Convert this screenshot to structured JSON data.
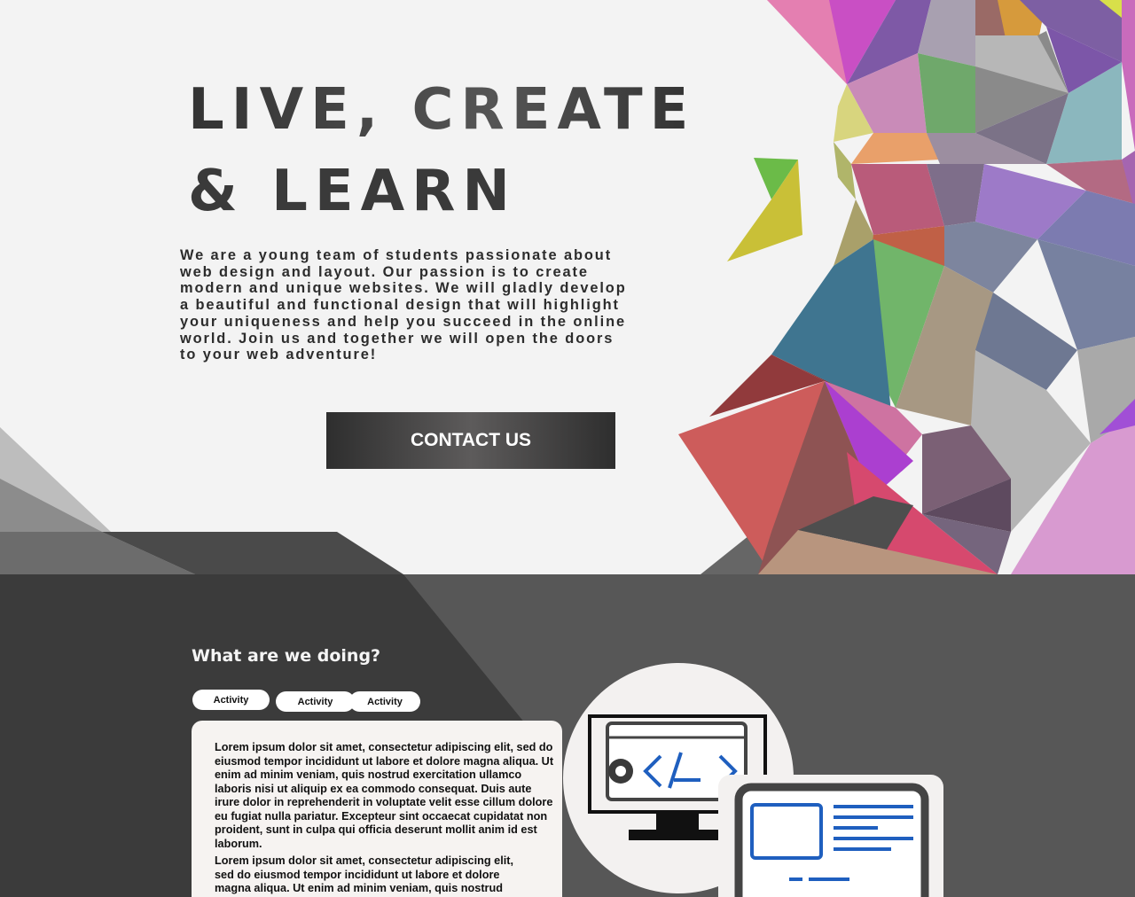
{
  "hero": {
    "headline_line1": "LIVE, CREATE",
    "headline_line2": "& LEARN",
    "intro_text": "We are a young team of students passionate about\nweb design and layout. Our passion is to create\nmodern and unique websites. We will gladly develop\na beautiful and functional design that will highlight\nyour uniqueness and help you succeed in the online\nworld. Join us and together we will open the doors\nto your web adventure!",
    "cta_label": "CONTACT US"
  },
  "services": {
    "title": "What are we doing?",
    "tabs": [
      {
        "label": "Activity"
      },
      {
        "label": "Activity"
      },
      {
        "label": "Activity"
      }
    ],
    "paragraph1": "Lorem ipsum dolor sit amet, consectetur adipiscing elit, sed do\neiusmod tempor incididunt ut labore et dolore magna aliqua. Ut\nenim ad minim veniam, quis nostrud exercitation ullamco\nlaboris nisi ut aliquip ex ea commodo consequat. Duis aute\nirure dolor in reprehenderit in voluptate velit esse cillum dolore\neu fugiat nulla pariatur. Excepteur sint occaecat cupidatat non\nproident, sunt in culpa qui officia deserunt mollit anim id est\nlaborum.",
    "paragraph2": "Lorem ipsum dolor sit amet, consectetur adipiscing elit,\nsed do eiusmod tempor incididunt ut labore et dolore\nmagna aliqua. Ut enim ad minim veniam, quis nostrud"
  },
  "icons": {
    "illustration_1": "code-monitor-icon",
    "illustration_2": "web-layout-icon"
  },
  "colors": {
    "page_background": "#f3f3f3",
    "section_background": "#575757",
    "dark_band": "#3b3b3b",
    "accent_blue": "#1f5fbf"
  }
}
